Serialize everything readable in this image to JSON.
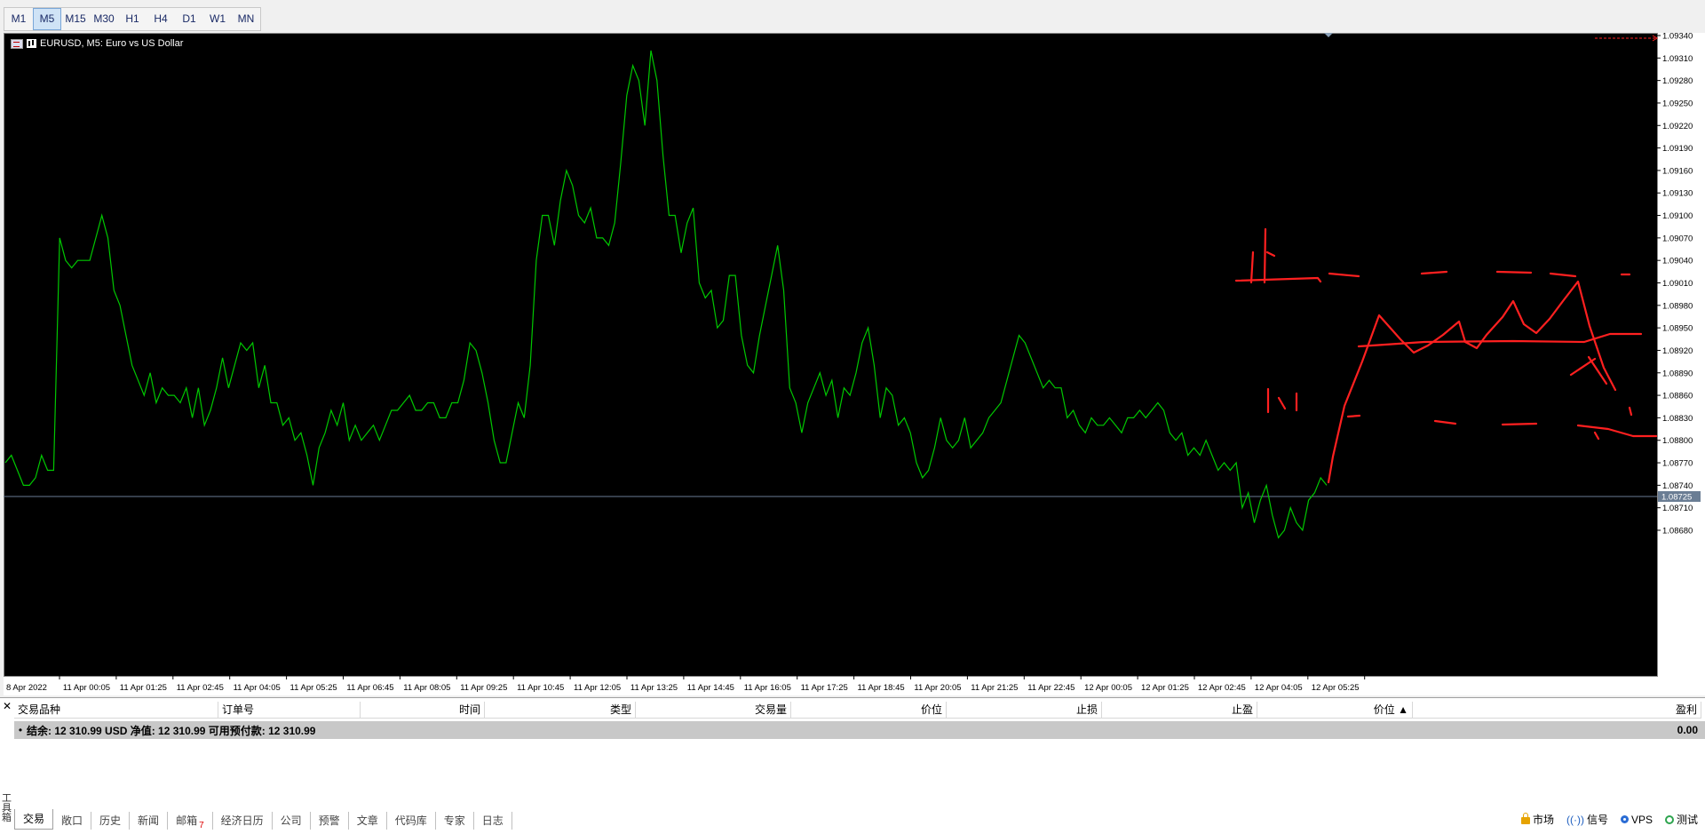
{
  "timeframes": [
    "M1",
    "M5",
    "M15",
    "M30",
    "H1",
    "H4",
    "D1",
    "W1",
    "MN"
  ],
  "active_timeframe": "M5",
  "chart": {
    "legend": "EURUSD, M5:  Euro vs US Dollar",
    "line_color": "#00c800",
    "annotation_color": "#ff2020",
    "current_price_label": "1.08725"
  },
  "chart_data": {
    "type": "line",
    "x_tick_labels": [
      "8 Apr 2022",
      "11 Apr 00:05",
      "11 Apr 01:25",
      "11 Apr 02:45",
      "11 Apr 04:05",
      "11 Apr 05:25",
      "11 Apr 06:45",
      "11 Apr 08:05",
      "11 Apr 09:25",
      "11 Apr 10:45",
      "11 Apr 12:05",
      "11 Apr 13:25",
      "11 Apr 14:45",
      "11 Apr 16:05",
      "11 Apr 17:25",
      "11 Apr 18:45",
      "11 Apr 20:05",
      "11 Apr 21:25",
      "11 Apr 22:45",
      "12 Apr 00:05",
      "12 Apr 01:25",
      "12 Apr 02:45",
      "12 Apr 04:05",
      "12 Apr 05:25"
    ],
    "y_tick_labels": [
      "1.09340",
      "1.09310",
      "1.09280",
      "1.09250",
      "1.09220",
      "1.09190",
      "1.09160",
      "1.09130",
      "1.09100",
      "1.09070",
      "1.09040",
      "1.09010",
      "1.08980",
      "1.08950",
      "1.08920",
      "1.08890",
      "1.08860",
      "1.08830",
      "1.08800",
      "1.08770",
      "1.08740",
      "1.08710",
      "1.08680"
    ],
    "ylim": [
      1.0865,
      1.0935
    ],
    "current_price": 1.08725,
    "series": [
      {
        "values": [
          1.0877,
          1.0878,
          1.0876,
          1.0874,
          1.0874,
          1.0875,
          1.0878,
          1.0876,
          1.0876,
          1.0907,
          1.0904,
          1.0903,
          1.0904,
          1.0904,
          1.0904,
          1.0907,
          1.091,
          1.0907,
          1.09,
          1.0898,
          1.0894,
          1.089,
          1.0888,
          1.0886,
          1.0889,
          1.0885,
          1.0887,
          1.0886,
          1.0886,
          1.0885,
          1.0887,
          1.0883,
          1.0887,
          1.0882,
          1.0884,
          1.0887,
          1.0891,
          1.0887,
          1.089,
          1.0893,
          1.0892,
          1.0893,
          1.0887,
          1.089,
          1.0885,
          1.0885,
          1.0882,
          1.0883,
          1.088,
          1.0881,
          1.0878,
          1.0874,
          1.0879,
          1.0881,
          1.0884,
          1.0882,
          1.0885,
          1.088,
          1.0882,
          1.088,
          1.0881,
          1.0882,
          1.088,
          1.0882,
          1.0884,
          1.0884,
          1.0885,
          1.0886,
          1.0884,
          1.0884,
          1.0885,
          1.0885,
          1.0883,
          1.0883,
          1.0885,
          1.0885,
          1.0888,
          1.0893,
          1.0892,
          1.0889,
          1.0885,
          1.088,
          1.0877,
          1.0877,
          1.0881,
          1.0885,
          1.0883,
          1.089,
          1.0904,
          1.091,
          1.091,
          1.0906,
          1.0912,
          1.0916,
          1.0914,
          1.091,
          1.0909,
          1.0911,
          1.0907,
          1.0907,
          1.0906,
          1.0909,
          1.0917,
          1.0926,
          1.093,
          1.0928,
          1.0922,
          1.0932,
          1.0928,
          1.0918,
          1.091,
          1.091,
          1.0905,
          1.0909,
          1.0911,
          1.0901,
          1.0899,
          1.09,
          1.0895,
          1.0896,
          1.0902,
          1.0902,
          1.0894,
          1.089,
          1.0889,
          1.0894,
          1.0898,
          1.0902,
          1.0906,
          1.09,
          1.0887,
          1.0885,
          1.0881,
          1.0885,
          1.0887,
          1.0889,
          1.0886,
          1.0888,
          1.0883,
          1.0887,
          1.0886,
          1.0889,
          1.0893,
          1.0895,
          1.089,
          1.0883,
          1.0887,
          1.0886,
          1.0882,
          1.0883,
          1.0881,
          1.0877,
          1.0875,
          1.0876,
          1.0879,
          1.0883,
          1.088,
          1.0879,
          1.088,
          1.0883,
          1.0879,
          1.088,
          1.0881,
          1.0883,
          1.0884,
          1.0885,
          1.0888,
          1.0891,
          1.0894,
          1.0893,
          1.0891,
          1.0889,
          1.0887,
          1.0888,
          1.0887,
          1.0887,
          1.0883,
          1.0884,
          1.0882,
          1.0881,
          1.0883,
          1.0882,
          1.0882,
          1.0883,
          1.0882,
          1.0881,
          1.0883,
          1.0883,
          1.0884,
          1.0883,
          1.0884,
          1.0885,
          1.0884,
          1.0881,
          1.088,
          1.0881,
          1.0878,
          1.0879,
          1.0878,
          1.088,
          1.0878,
          1.0876,
          1.0877,
          1.0876,
          1.0877,
          1.0871,
          1.0873,
          1.0869,
          1.0872,
          1.0874,
          1.087,
          1.0867,
          1.0868,
          1.0871,
          1.0869,
          1.0868,
          1.0872,
          1.0873,
          1.0875,
          1.0874
        ]
      }
    ],
    "grid": false,
    "legend_position": "top-left"
  },
  "terminal": {
    "columns": [
      "交易品种",
      "订单号",
      "时间",
      "类型",
      "交易量",
      "价位",
      "止损",
      "止盈",
      "价位",
      "盈利"
    ],
    "balance_text": "结余: 12 310.99 USD  净值: 12 310.99  可用预付款: 12 310.99",
    "profit": "0.00",
    "side_label": "工具箱",
    "tabs": [
      {
        "label": "交易",
        "badge": ""
      },
      {
        "label": "敞口",
        "badge": ""
      },
      {
        "label": "历史",
        "badge": ""
      },
      {
        "label": "新闻",
        "badge": ""
      },
      {
        "label": "邮箱",
        "badge": "7"
      },
      {
        "label": "经济日历",
        "badge": ""
      },
      {
        "label": "公司",
        "badge": ""
      },
      {
        "label": "预警",
        "badge": ""
      },
      {
        "label": "文章",
        "badge": ""
      },
      {
        "label": "代码库",
        "badge": ""
      },
      {
        "label": "专家",
        "badge": ""
      },
      {
        "label": "日志",
        "badge": ""
      }
    ],
    "active_tab": "交易",
    "status": [
      {
        "label": "市场",
        "icon": "lock-icon"
      },
      {
        "label": "信号",
        "icon": "signal-icon"
      },
      {
        "label": "VPS",
        "icon": "vps-icon"
      },
      {
        "label": "测试",
        "icon": "test-icon"
      }
    ]
  }
}
